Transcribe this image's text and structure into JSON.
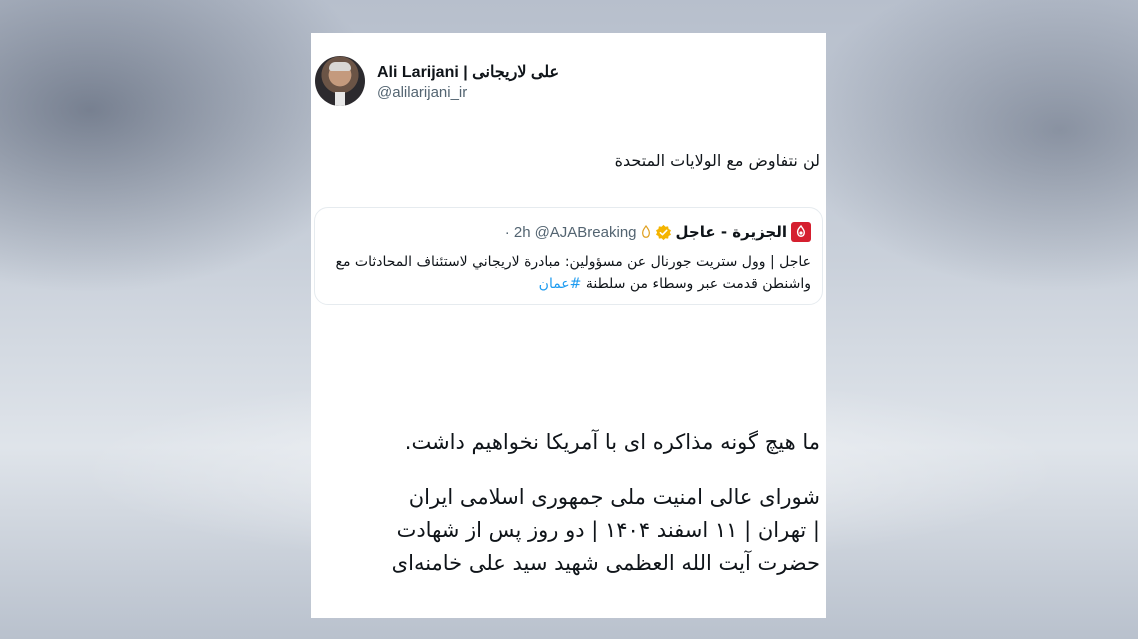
{
  "tweet": {
    "author_name": "Ali Larijani | علی لاریجانی",
    "author_handle": "@alilarijani_ir",
    "text": "لن نتفاوض مع الولايات المتحدة",
    "quoted": {
      "name": "الجزيرة - عاجل",
      "handle": "@AJABreaking",
      "time": "· 2h",
      "text": "عاجل | وول ستريت جورنال عن مسؤولين: مبادرة لاريجاني لاستئناف المحادثات مع واشنطن قدمت عبر وسطاء من سلطنة",
      "hashtag": "#عمان",
      "logo_color": "#d51f2f"
    }
  },
  "caption": {
    "line1": "ما هیچ گونه مذاکره ای با آمریکا نخواهیم داشت.",
    "line2": "شورای عالی امنیت ملی جمهوری اسلامی ایران",
    "line3": "| تهران | ۱۱ اسفند ۱۴۰۴ | دو روز پس از شهادت",
    "line4": "حضرت آیت الله العظمی شهید سید علی خامنه‌ای"
  },
  "colors": {
    "verified": "#f4b400",
    "hashtag": "#1d9bf0",
    "secondary_text": "#536471"
  }
}
